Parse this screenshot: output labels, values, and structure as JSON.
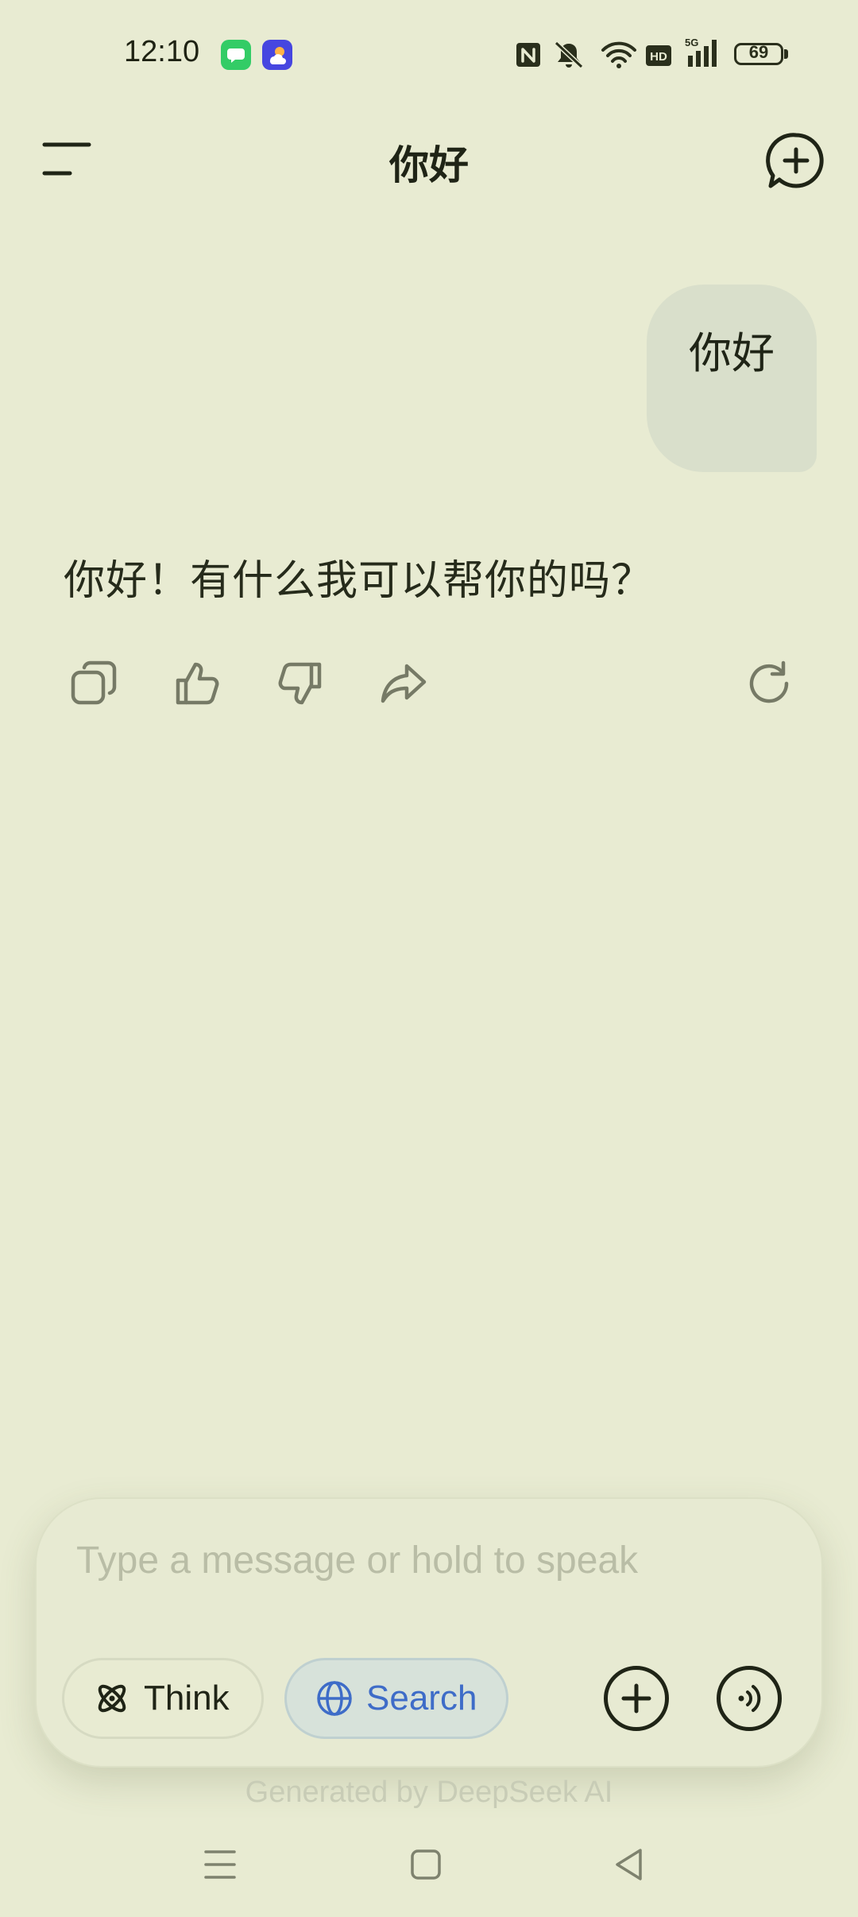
{
  "status_bar": {
    "time": "12:10",
    "battery_level": "69",
    "icons": [
      "chat-app-icon",
      "weather-app-icon",
      "nfc-icon",
      "bell-muted-icon",
      "wifi-icon",
      "hd-icon",
      "signal-5g-icon",
      "battery-icon"
    ]
  },
  "header": {
    "title": "你好",
    "icons": [
      "menu-icon",
      "new-chat-icon"
    ]
  },
  "conversation": {
    "user_message": "你好",
    "assistant_message": "你好！有什么我可以帮你的吗？",
    "actions": [
      "copy-icon",
      "thumbs-up-icon",
      "thumbs-down-icon",
      "share-icon",
      "regenerate-icon"
    ]
  },
  "composer": {
    "placeholder": "Type a message or hold to speak",
    "think_label": "Think",
    "search_label": "Search",
    "search_active": true,
    "accent_color": "#3E6CC8"
  },
  "footer": {
    "note": "Generated by DeepSeek AI"
  },
  "nav_bar": {
    "icons": [
      "recents-icon",
      "home-icon",
      "back-icon"
    ]
  }
}
